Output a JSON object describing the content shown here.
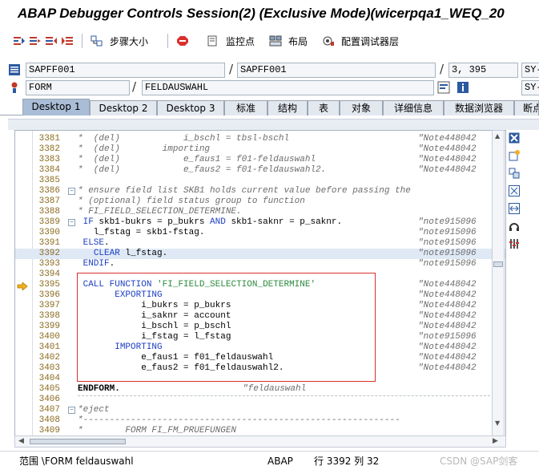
{
  "window": {
    "title": "ABAP Debugger Controls Session(2)  (Exclusive Mode)(wicerpqa1_WEQ_20"
  },
  "toolbar": {
    "step_size_label": "步骤大小",
    "watchpoint_label": "监控点",
    "layout_label": "布局",
    "configure_label": "配置调试器层"
  },
  "fields": {
    "program1": "SAPFF001",
    "program2": "SAPFF001",
    "line_no": "3, 395",
    "sy_label1": "SY-",
    "event_type": "FORM",
    "event_name": "FELDAUSWAHL",
    "sy_label2": "SY-"
  },
  "tabs": [
    {
      "label": "Desktop 1",
      "active": true
    },
    {
      "label": "Desktop 2",
      "active": false
    },
    {
      "label": "Desktop 3",
      "active": false
    },
    {
      "label": "标准",
      "active": false
    },
    {
      "label": "结构",
      "active": false
    },
    {
      "label": "表",
      "active": false
    },
    {
      "label": "对象",
      "active": false
    },
    {
      "label": "详细信息",
      "active": false
    },
    {
      "label": "数据浏览器",
      "active": false
    },
    {
      "label": "断点",
      "active": false
    }
  ],
  "code": [
    {
      "n": "3381",
      "t": "*  (del)            i_bschl = tbsl-bschl",
      "note": "\"Note448042",
      "cls": "cm"
    },
    {
      "n": "3382",
      "t": "*  (del)        importing",
      "note": "\"Note448042",
      "cls": "cm"
    },
    {
      "n": "3383",
      "t": "*  (del)            e_faus1 = f01-feldauswahl",
      "note": "\"Note448042",
      "cls": "cm"
    },
    {
      "n": "3384",
      "t": "*  (del)            e_faus2 = f01-feldauswahl2.",
      "note": "\"Note448042",
      "cls": "cm"
    },
    {
      "n": "3385",
      "t": "",
      "note": "",
      "cls": ""
    },
    {
      "n": "3386",
      "t": "* ensure field list SKB1 holds current value before passing the",
      "note": "",
      "cls": "cm",
      "fold": "-"
    },
    {
      "n": "3387",
      "t": "* (optional) field status group to function",
      "note": "",
      "cls": "cm"
    },
    {
      "n": "3388",
      "t": "* FI_FIELD_SELECTION_DETERMINE.",
      "note": "",
      "cls": "cm"
    },
    {
      "n": "3389",
      "t": " IF skb1-bukrs = p_bukrs AND skb1-saknr = p_saknr.",
      "note": "\"note915096",
      "cls": "",
      "fold": "-"
    },
    {
      "n": "3390",
      "t": "   l_fstag = skb1-fstag.",
      "note": "\"note915096",
      "cls": ""
    },
    {
      "n": "3391",
      "t": " ELSE.",
      "note": "\"note915096",
      "cls": ""
    },
    {
      "n": "3392",
      "t": "   CLEAR l_fstag.",
      "note": "\"note915096",
      "cls": "",
      "hl": true
    },
    {
      "n": "3393",
      "t": " ENDIF.",
      "note": "\"note915096",
      "cls": ""
    },
    {
      "n": "3394",
      "t": "",
      "note": "",
      "cls": ""
    },
    {
      "n": "3395",
      "t": " CALL FUNCTION 'FI_FIELD_SELECTION_DETERMINE'",
      "note": "\"Note448042",
      "cls": ""
    },
    {
      "n": "3396",
      "t": "       EXPORTING",
      "note": "\"Note448042",
      "cls": ""
    },
    {
      "n": "3397",
      "t": "            i_bukrs = p_bukrs",
      "note": "\"Note448042",
      "cls": ""
    },
    {
      "n": "3398",
      "t": "            i_saknr = account",
      "note": "\"Note448042",
      "cls": ""
    },
    {
      "n": "3399",
      "t": "            i_bschl = p_bschl",
      "note": "\"Note448042",
      "cls": ""
    },
    {
      "n": "3400",
      "t": "            i_fstag = l_fstag",
      "note": "\"note915096",
      "cls": ""
    },
    {
      "n": "3401",
      "t": "       IMPORTING",
      "note": "\"Note448042",
      "cls": ""
    },
    {
      "n": "3402",
      "t": "            e_faus1 = f01_feldauswahl",
      "note": "\"Note448042",
      "cls": ""
    },
    {
      "n": "3403",
      "t": "            e_faus2 = f01_feldauswahl2.",
      "note": "\"Note448042",
      "cls": ""
    },
    {
      "n": "3404",
      "t": "",
      "note": "",
      "cls": ""
    },
    {
      "n": "3405",
      "t": "ENDFORM.",
      "note": "",
      "cls": "",
      "endform_note": "\"feldauswahl"
    },
    {
      "n": "3406",
      "t": "",
      "note": "",
      "cls": ""
    },
    {
      "n": "3407",
      "t": "*eject",
      "note": "",
      "cls": "cm",
      "fold": "-"
    },
    {
      "n": "3408",
      "t": "*------------------------------------------------------------",
      "note": "",
      "cls": "cm"
    },
    {
      "n": "3409",
      "t": "*        FORM FI_FM_PRUEFUNGEN",
      "note": "",
      "cls": "cm"
    }
  ],
  "status": {
    "scope": "范围 \\FORM feldauswahl",
    "language": "ABAP",
    "position": "行 3392 列  32",
    "watermark": "CSDN @SAP剑客"
  },
  "colors": {
    "keyword": "#1f40c4",
    "string": "#2b8a3e",
    "comment": "#6c6c6c",
    "highlight_box": "#d9302f",
    "active_tab": "#a9bdd6"
  }
}
